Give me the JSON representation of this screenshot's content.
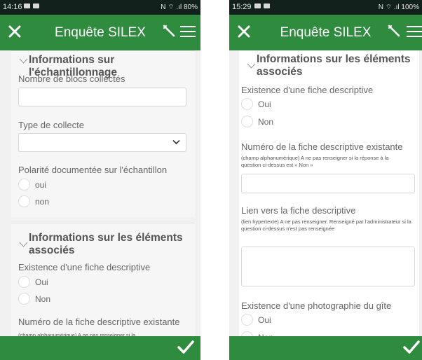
{
  "colors": {
    "appbar": "#2f8b3e",
    "statusbar": "#12211c",
    "background": "#f1f1f1"
  },
  "left": {
    "status": {
      "time": "14:16",
      "system": "N ⌔ .ıl 80%"
    },
    "appbar": {
      "close_icon": "close-icon",
      "title": "Enquête SILEX",
      "tool_icon": "magic-wand-icon",
      "menu_icon": "hamburger-menu-icon"
    },
    "sections": {
      "echantillonnage": {
        "title": "Informations sur l'échantillonnage",
        "nb_blocs_label": "Nombre de blocs collectés",
        "nb_blocs_value": "",
        "type_collecte_label": "Type de collecte",
        "type_collecte_value": "",
        "polarite_label": "Polarité documentée sur l'échantillon",
        "polarite_options": [
          "oui",
          "non"
        ]
      },
      "elements": {
        "title_line1": "Informations sur les éléments",
        "title_line2": "associés",
        "existence_label": "Existence d'une fiche descriptive",
        "existence_options": [
          "Oui",
          "Non"
        ],
        "numero_label": "Numéro de la fiche descriptive existante",
        "numero_note_partial": "(champ alphanumérique) A ne pas renseigner si la"
      }
    },
    "bottom": {
      "check_icon": "check-icon"
    }
  },
  "right": {
    "status": {
      "time": "15:29",
      "system": "N ⌔ .ıl 100%"
    },
    "appbar": {
      "close_icon": "close-icon",
      "title": "Enquête SILEX",
      "tool_icon": "magic-wand-icon",
      "menu_icon": "hamburger-menu-icon"
    },
    "section": {
      "title_line1": "Informations sur les éléments",
      "title_line2": "associés",
      "existence_label": "Existence d'une fiche descriptive",
      "existence_options": [
        "Oui",
        "Non"
      ],
      "numero_label": "Numéro de la fiche descriptive existante",
      "numero_note": "(champ alphanumérique) A ne pas renseigner si la réponse à la question ci-dessus est « Non »",
      "numero_value": "",
      "lien_label": "Lien vers la fiche descriptive",
      "lien_note": "(lien hypertexte) A ne pas renseigner. Renseigné par l'administrateur si la question ci-dessus n'est pas renseignée",
      "lien_value": "",
      "photo_label": "Existence d'une photographie du gîte",
      "photo_options": [
        "Oui",
        "Non"
      ]
    },
    "bottom": {
      "check_icon": "check-icon"
    }
  }
}
